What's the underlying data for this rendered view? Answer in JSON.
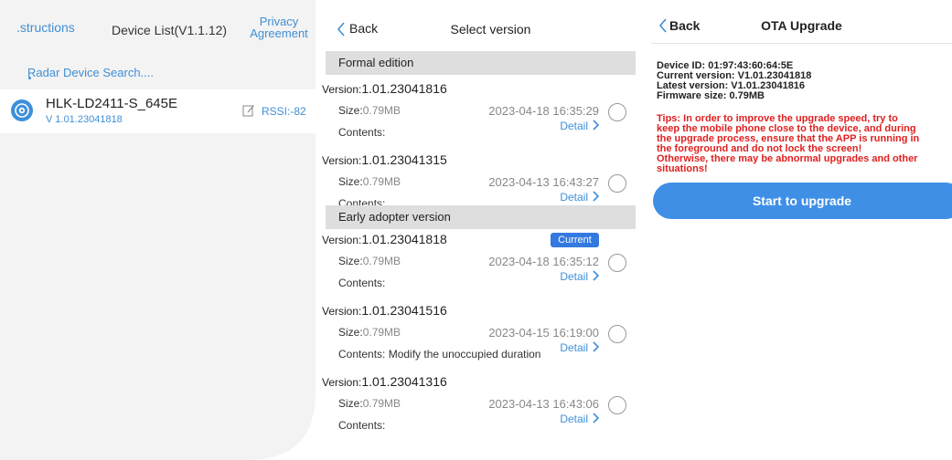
{
  "panel1": {
    "instructions_label": ".structions",
    "title": "Device List(V1.1.12)",
    "privacy_line1": "Privacy",
    "privacy_line2": "Agreement",
    "search_label": "Radar Device Search....",
    "device": {
      "name": "HLK-LD2411-S_645E",
      "version": "V 1.01.23041818",
      "rssi": "RSSI:-82",
      "icon": "radar-icon"
    }
  },
  "panel2": {
    "back_label": "Back",
    "title": "Select version",
    "sections": {
      "formal": "Formal edition",
      "early": "Early adopter version"
    },
    "labels": {
      "version": "Version:",
      "size": "Size:",
      "contents": "Contents:",
      "detail": "Detail",
      "current": "Current"
    },
    "formal_items": [
      {
        "version": "1.01.23041816",
        "size": "0.79MB",
        "date": "2023-04-18 16:35:29",
        "contents": ""
      },
      {
        "version": "1.01.23041315",
        "size": "0.79MB",
        "date": "2023-04-13 16:43:27",
        "contents": ""
      }
    ],
    "early_items": [
      {
        "version": "1.01.23041818",
        "size": "0.79MB",
        "date": "2023-04-18 16:35:12",
        "contents": "",
        "current": true
      },
      {
        "version": "1.01.23041516",
        "size": "0.79MB",
        "date": "2023-04-15 16:19:00",
        "contents": " Modify the unoccupied duration"
      },
      {
        "version": "1.01.23041316",
        "size": "0.79MB",
        "date": "2023-04-13 16:43:06",
        "contents": ""
      }
    ]
  },
  "panel3": {
    "back_label": "Back",
    "title": "OTA Upgrade",
    "device_id": "Device ID: 01:97:43:60:64:5E",
    "current_version": "Current version: V1.01.23041818",
    "latest_version": "Latest version: V1.01.23041816",
    "firmware_size": "Firmware size: 0.79MB",
    "tips": "Tips: In order to improve the upgrade speed, try to\nkeep the mobile phone close to the device, and during\nthe upgrade process, ensure that the APP is running in\nthe foreground and do not lock the screen!\nOtherwise, there may be abnormal upgrades and other\nsituations!",
    "upgrade_button": "Start to upgrade"
  },
  "colors": {
    "accent_blue": "#3f8fd6",
    "button_blue": "#3f8fe6",
    "current_badge": "#3479e0",
    "tips_red": "#e02020",
    "section_grey": "#dedede"
  }
}
